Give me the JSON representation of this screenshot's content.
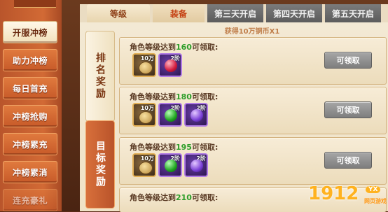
{
  "sidebar": {
    "items": [
      {
        "label": "开服冲榜",
        "active": true
      },
      {
        "label": "助力冲榜"
      },
      {
        "label": "每日首充"
      },
      {
        "label": "冲榜抢购"
      },
      {
        "label": "冲榜累充"
      },
      {
        "label": "冲榜累消"
      },
      {
        "label": "连充豪礼"
      }
    ]
  },
  "tabs": [
    "等级",
    "装备",
    "第三天开启",
    "第四天开启",
    "第五天开启"
  ],
  "side_tabs": {
    "rank": "排名奖励",
    "target": "目标奖励"
  },
  "notice": "获得10万铜币X1",
  "cards": [
    {
      "prefix": "角色等级达到",
      "level": "160",
      "suffix": "可领取:",
      "button": "可领取",
      "items": [
        {
          "type": "coin",
          "label": "10万"
        },
        {
          "type": "red-orb",
          "label": "2阶"
        }
      ]
    },
    {
      "prefix": "角色等级达到",
      "level": "180",
      "suffix": "可领取:",
      "button": "可领取",
      "items": [
        {
          "type": "coin",
          "label": "10万"
        },
        {
          "type": "green-orb",
          "label": "2阶"
        },
        {
          "type": "violet-orb",
          "label": "2阶"
        }
      ]
    },
    {
      "prefix": "角色等级达到",
      "level": "195",
      "suffix": "可领取:",
      "button": "可领取",
      "items": [
        {
          "type": "coin",
          "label": "10万"
        },
        {
          "type": "green-orb",
          "label": "2阶"
        },
        {
          "type": "violet-orb",
          "label": "2阶"
        }
      ]
    },
    {
      "prefix": "角色等级达到",
      "level": "210",
      "suffix": "可领取:"
    }
  ],
  "watermark": {
    "number": "1912",
    "badge": "YX",
    "sub": "网页游戏"
  },
  "colors": {
    "accent": "#c75a29",
    "level_text": "#2e9e2a",
    "claim_button": "#8c8c8c",
    "panel": "#f3e9d4"
  }
}
